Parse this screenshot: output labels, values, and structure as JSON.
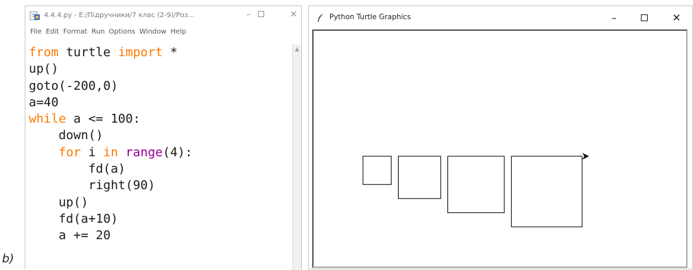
{
  "figure_label": "b)",
  "idle": {
    "title": "4.4.4.py - E:/Підручники/7 клас (2-9)/Роз...",
    "menu": [
      "File",
      "Edit",
      "Format",
      "Run",
      "Options",
      "Window",
      "Help"
    ],
    "code": [
      [
        {
          "t": "from",
          "c": "kw"
        },
        {
          "t": " turtle ",
          "c": ""
        },
        {
          "t": "import",
          "c": "kw"
        },
        {
          "t": " *",
          "c": ""
        }
      ],
      [
        {
          "t": "up()",
          "c": ""
        }
      ],
      [
        {
          "t": "goto(-200,0)",
          "c": ""
        }
      ],
      [
        {
          "t": "a=40",
          "c": ""
        }
      ],
      [
        {
          "t": "while",
          "c": "kw"
        },
        {
          "t": " a <= 100:",
          "c": ""
        }
      ],
      [
        {
          "t": "    down()",
          "c": ""
        }
      ],
      [
        {
          "t": "    ",
          "c": ""
        },
        {
          "t": "for",
          "c": "kw"
        },
        {
          "t": " i ",
          "c": ""
        },
        {
          "t": "in",
          "c": "kw"
        },
        {
          "t": " ",
          "c": ""
        },
        {
          "t": "range",
          "c": "bi"
        },
        {
          "t": "(4):",
          "c": ""
        }
      ],
      [
        {
          "t": "        fd(a)",
          "c": ""
        }
      ],
      [
        {
          "t": "        right(90)",
          "c": ""
        }
      ],
      [
        {
          "t": "    up()",
          "c": ""
        }
      ],
      [
        {
          "t": "    fd(a+10)",
          "c": ""
        }
      ],
      [
        {
          "t": "    a += 20",
          "c": ""
        }
      ]
    ],
    "colors": {
      "keyword": "#ff7700",
      "builtin": "#900090",
      "text": "#1a1a1a"
    }
  },
  "turtle": {
    "title": "Python Turtle Graphics",
    "icons": {
      "app": "feather-icon",
      "minimize": "minimize-icon",
      "maximize": "maximize-icon",
      "close": "close-icon"
    },
    "program": {
      "start": [
        -200,
        0
      ],
      "a_start": 40,
      "a_stop": 100,
      "a_step": 20,
      "gap": 10
    },
    "line_color": "#000000"
  }
}
